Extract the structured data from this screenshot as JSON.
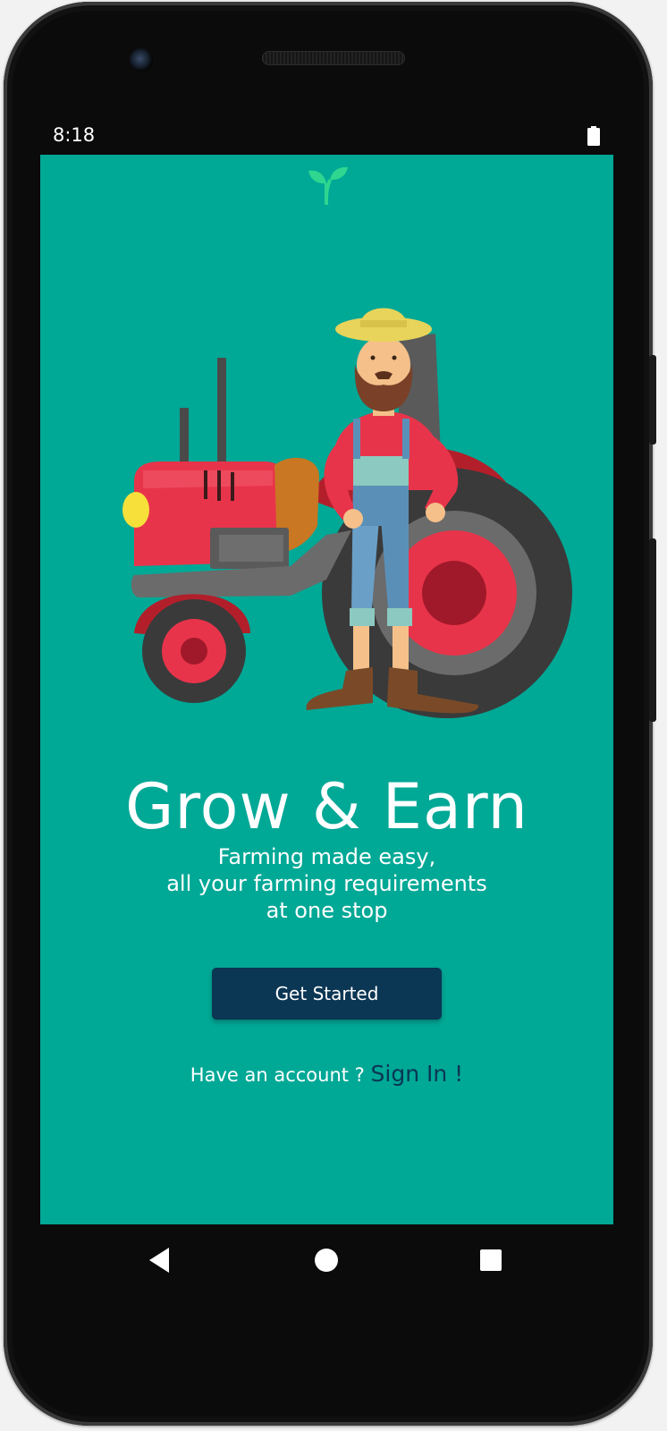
{
  "status_bar": {
    "time": "8:18"
  },
  "hero": {
    "title": "Grow & Earn",
    "subtitle_lines": [
      "Farming made easy,",
      "all your farming requirements",
      "at one stop"
    ]
  },
  "actions": {
    "get_started_label": "Get Started",
    "have_account_text": "Have an account ?",
    "sign_in_label": "Sign In !"
  },
  "colors": {
    "background": "#00a896",
    "button": "#0b3654",
    "sign_in_text": "#0b3654",
    "logo_sprout": "#2ed68f"
  },
  "icons": {
    "logo": "sprout-icon",
    "status_battery": "battery-icon",
    "nav_back": "back-triangle-icon",
    "nav_home": "home-circle-icon",
    "nav_recents": "recents-square-icon"
  }
}
